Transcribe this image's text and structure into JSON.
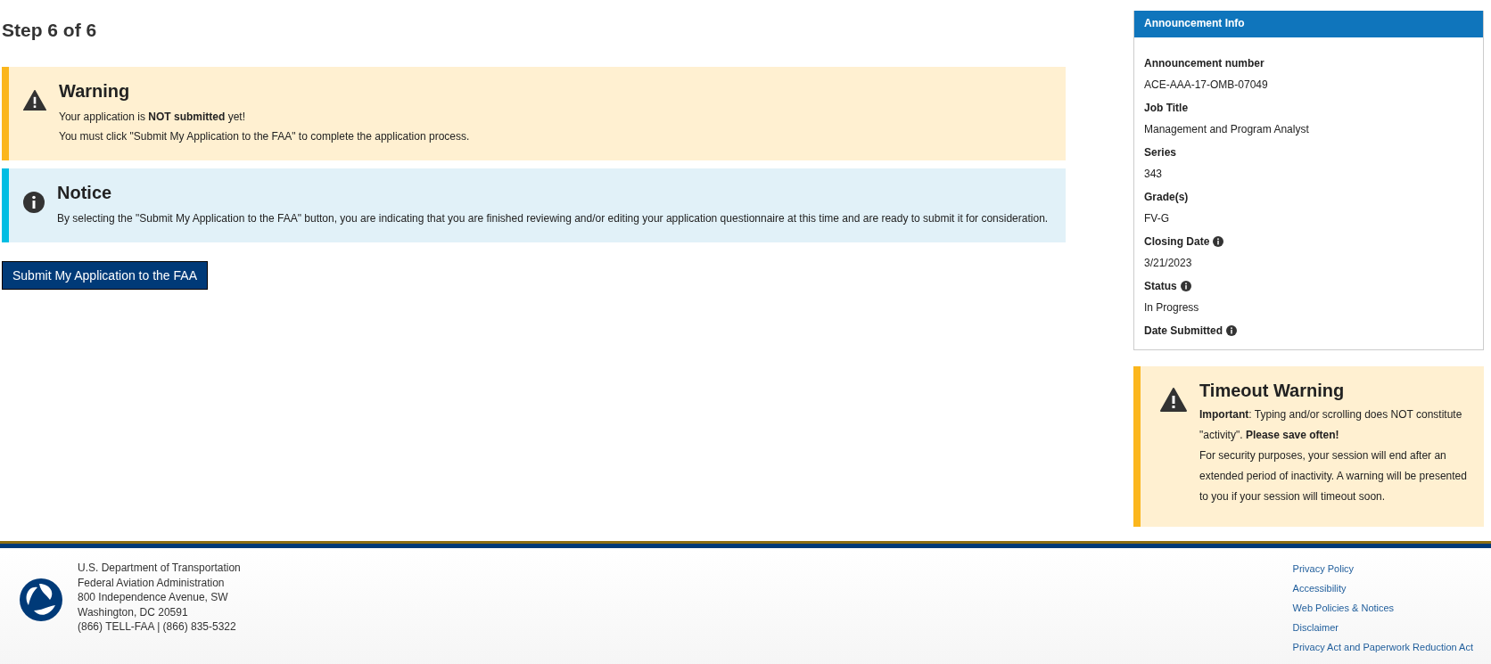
{
  "page_title": "Step 6 of 6",
  "alerts": [
    {
      "kind": "warning",
      "title": "Warning",
      "lines": [
        "Your application is **NOT submitted** yet!",
        "You must click \"Submit My Application to the FAA\" to complete the application process."
      ]
    },
    {
      "kind": "notice",
      "title": "Notice",
      "lines": [
        "By selecting the \"Submit My Application to the FAA\" button, you are indicating that you are finished reviewing and/or editing your application questionnaire at this time and are ready to submit it for consideration."
      ]
    }
  ],
  "submit_button": "Submit My Application to the FAA",
  "announcement_info": {
    "title": "Announcement Info",
    "items": [
      {
        "label": "Announcement number",
        "value": "ACE-AAA-17-OMB-07049",
        "info_icon": false
      },
      {
        "label": "Job Title",
        "value": "Management and Program Analyst",
        "info_icon": false
      },
      {
        "label": "Series",
        "value": "343",
        "info_icon": false
      },
      {
        "label": "Grade(s)",
        "value": "FV-G",
        "info_icon": false
      },
      {
        "label": "Closing Date",
        "value": "3/21/2023",
        "info_icon": true
      },
      {
        "label": "Status",
        "value": "In Progress",
        "info_icon": true
      },
      {
        "label": "Date Submitted",
        "info_icon": true
      }
    ]
  },
  "timeout_warning": {
    "title": "Timeout Warning",
    "lines": [
      "**Important**: Typing and/or scrolling does NOT constitute \"activity\". **Please save often!**",
      "For security purposes, your session will end after an extended period of inactivity. A warning will be presented to you if your session will timeout soon."
    ]
  },
  "footer": {
    "address": [
      "U.S. Department of Transportation",
      "Federal Aviation Administration",
      "800 Independence Avenue, SW",
      "Washington, DC 20591",
      "(866) TELL-FAA | (866) 835-5322"
    ],
    "links": [
      "Privacy Policy",
      "Accessibility",
      "Web Policies & Notices",
      "Disclaimer",
      "Privacy Act and Paperwork Reduction Act"
    ]
  }
}
